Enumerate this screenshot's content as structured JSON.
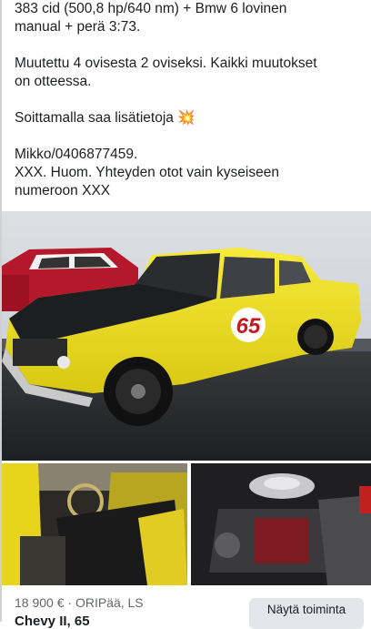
{
  "post": {
    "line1": "383 cid (500,8 hp/640 nm) + Bmw 6 lovinen",
    "line2": "manual + perä 3:73.",
    "line3": "Muutettu 4 ovisesta 2 oviseksi. Kaikki muutokset",
    "line4": "on otteessa.",
    "line5": "Soittamalla saa lisätietoja",
    "line5_emoji": "💥",
    "line6": "Mikko/0406877459.",
    "line7": "XXX. Huom. Yhteyden otot vain kyseiseen",
    "line8": "numeroon XXX"
  },
  "car": {
    "race_number": "65"
  },
  "listing": {
    "meta": "18 900 € · ORIPää, LS",
    "title": "Chevy II, 65",
    "action_label": "Näytä toiminta"
  },
  "colors": {
    "car_yellow": "#f1e31c",
    "button_bg": "#e4e6eb",
    "meta_gray": "#65676b"
  }
}
